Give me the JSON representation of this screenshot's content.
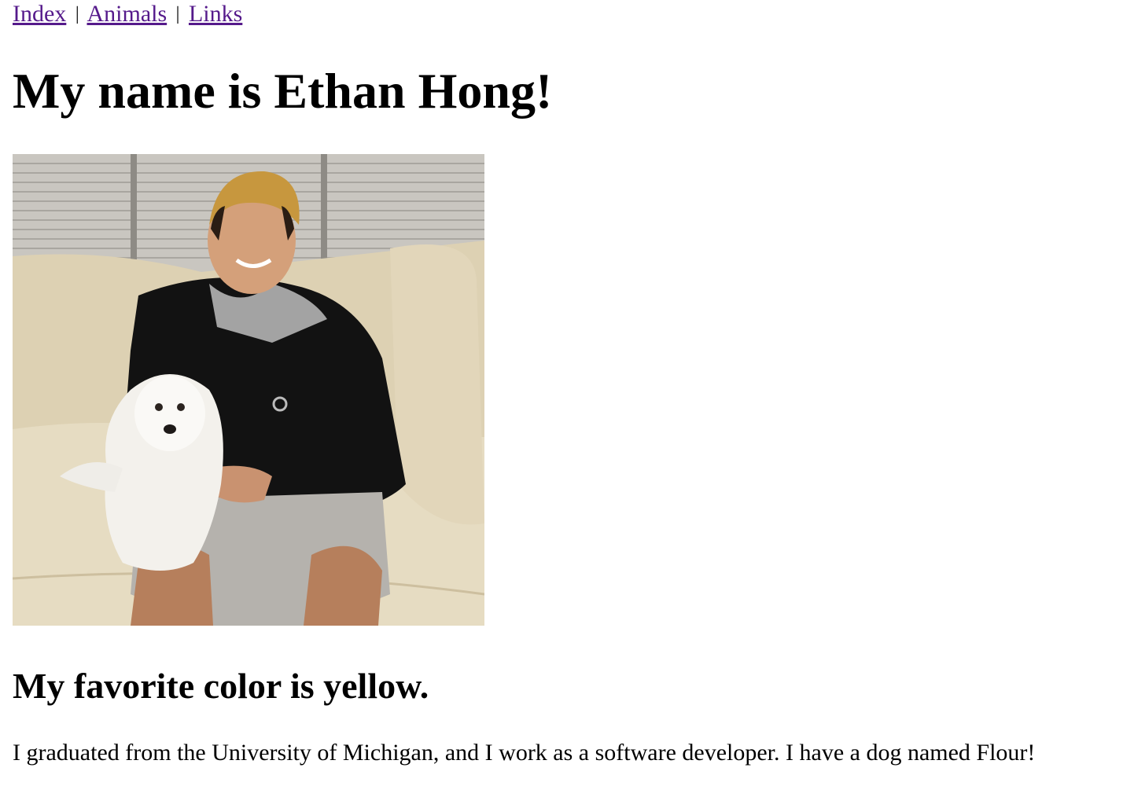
{
  "nav": {
    "links": [
      "Index",
      "Animals",
      "Links"
    ],
    "separator": "|",
    "link_color": "#551a8b"
  },
  "heading": "My name is Ethan Hong!",
  "photo": {
    "icon": "profile-photo"
  },
  "subheading": "My favorite color is yellow.",
  "bio": "I graduated from the University of Michigan, and I work as a software developer. I have a dog named Flour!"
}
